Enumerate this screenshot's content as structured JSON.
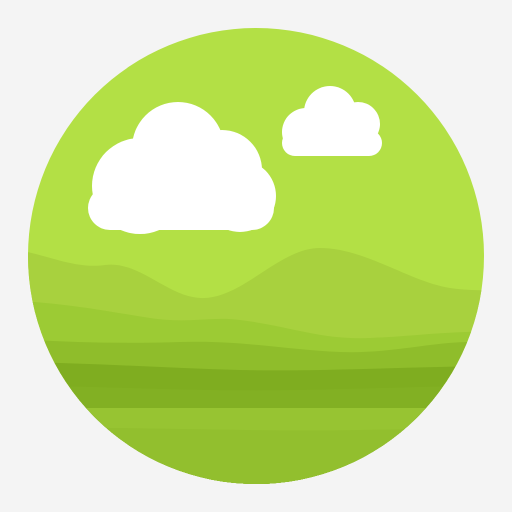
{
  "icon": {
    "name": "landscape-app-icon",
    "description_visible_text": ""
  },
  "colors": {
    "background": "#f4f4f4",
    "sky": "#b3e045",
    "hill_back": "#a8d13e",
    "hill_mid": "#9ccb34",
    "hill_front": "#8fbd2b",
    "ground_dark": "#7fad20",
    "ground_light": "#8bb927",
    "lake": "#97c432",
    "clouds": "#ffffff"
  }
}
